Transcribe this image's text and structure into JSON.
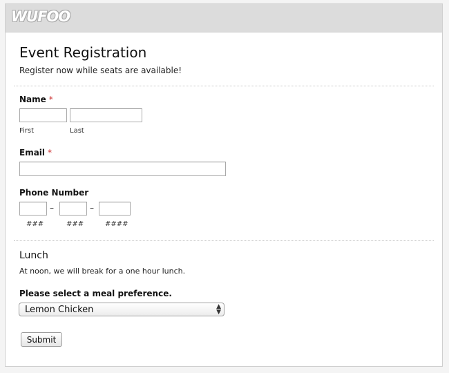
{
  "brand": {
    "logo_text": "WUFOO"
  },
  "form": {
    "title": "Event Registration",
    "description": "Register now while seats are available!",
    "name": {
      "label": "Name",
      "required_mark": "*",
      "first_label": "First",
      "last_label": "Last",
      "first_value": "",
      "last_value": ""
    },
    "email": {
      "label": "Email",
      "required_mark": "*",
      "value": ""
    },
    "phone": {
      "label": "Phone Number",
      "separator": "–",
      "part1_hint": "###",
      "part2_hint": "###",
      "part3_hint": "####"
    },
    "lunch": {
      "title": "Lunch",
      "description": "At noon, we will break for a one hour lunch.",
      "meal_label": "Please select a meal preference.",
      "meal_selected": "Lemon Chicken"
    },
    "submit_label": "Submit"
  }
}
